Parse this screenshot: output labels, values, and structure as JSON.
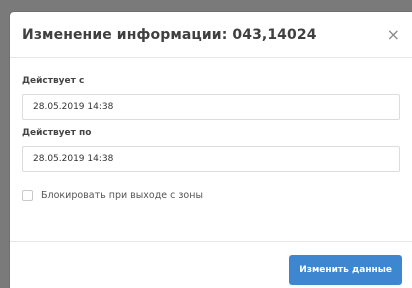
{
  "modal": {
    "title": "Изменение информации: 043,14024",
    "close_symbol": "×",
    "fields": [
      {
        "label": "Действует с",
        "value": "28.05.2019 14:38"
      },
      {
        "label": "Действует по",
        "value": "28.05.2019 14:38"
      }
    ],
    "checkbox": {
      "label": "Блокировать при выходе с зоны",
      "checked": false
    },
    "submit_label": "Изменить данные"
  },
  "colors": {
    "primary": "#3f86d1",
    "backdrop": "#7a7a7a"
  },
  "icons": {
    "close": "close-icon",
    "checkbox": "checkbox-icon"
  }
}
